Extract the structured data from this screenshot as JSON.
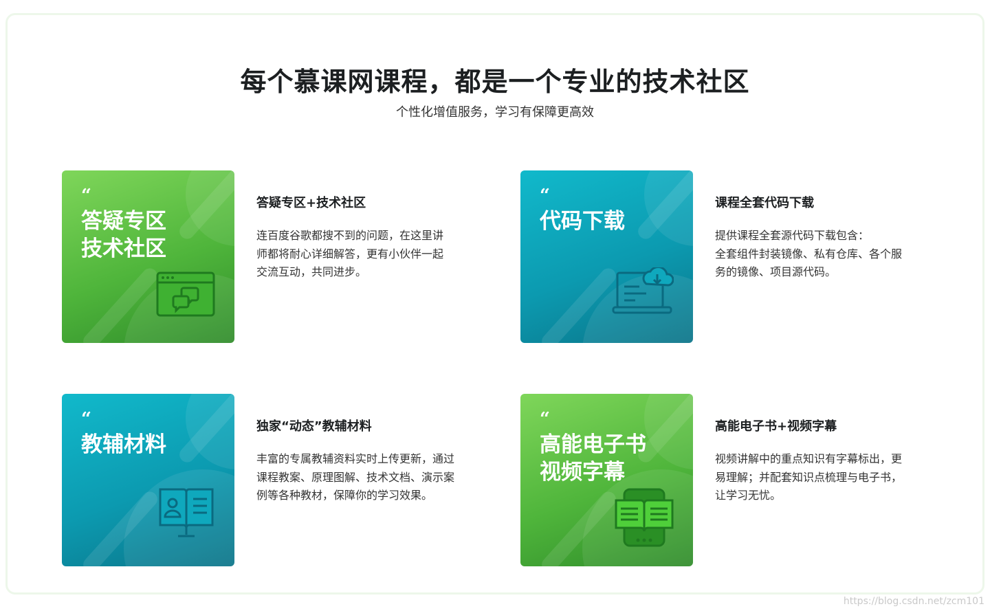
{
  "section": {
    "title": "每个慕课网课程，都是一个专业的技术社区",
    "subtitle": "个性化增值服务，学习有保障更高效"
  },
  "features": [
    {
      "tile_quote": "“",
      "tile_title": "答疑专区\n技术社区",
      "tile_icon": "chat-window-icon",
      "title": "答疑专区+技术社区",
      "description": "连百度谷歌都搜不到的问题，在这里讲\n师都将耐心详细解答，更有小伙伴一起\n交流互动，共同进步。"
    },
    {
      "tile_quote": "“",
      "tile_title": "代码下载",
      "tile_icon": "cloud-download-laptop-icon",
      "title": "课程全套代码下载",
      "description": "提供课程全套源代码下载包含：\n全套组件封装镜像、私有仓库、各个服\n务的镜像、项目源代码。"
    },
    {
      "tile_quote": "“",
      "tile_title": "教辅材料",
      "tile_icon": "open-book-profile-icon",
      "title": "独家“动态”教辅材料",
      "description": "丰富的专属教辅资料实时上传更新，通过\n课程教案、原理图解、技术文档、演示案\n例等各种教材，保障你的学习效果。"
    },
    {
      "tile_quote": "“",
      "tile_title": "高能电子书\n视频字幕",
      "tile_icon": "ebook-tablet-icon",
      "title": "高能电子书+视频字幕",
      "description": "视频讲解中的重点知识有字幕标出，更\n易理解；并配套知识点梳理与电子书，\n让学习无忧。"
    }
  ],
  "watermark": "https://blog.csdn.net/zcm101",
  "colors": {
    "green_tile": "#4fb53b",
    "teal_tile": "#0c9ab0",
    "icon_green": "#1f7a1f",
    "icon_teal": "#0a6a80"
  }
}
